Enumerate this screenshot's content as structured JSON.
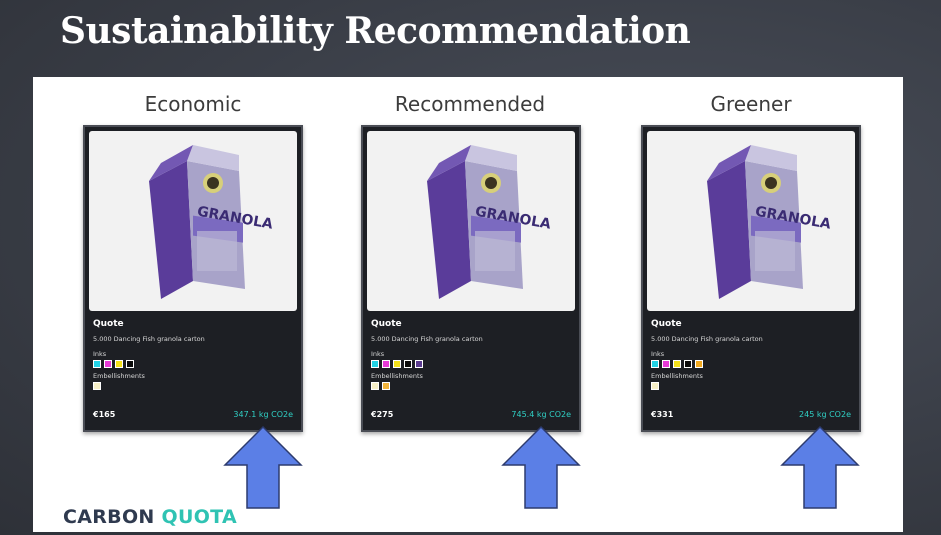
{
  "slide": {
    "title": "Sustainability Recommendation"
  },
  "logo": {
    "part1": "CARBON",
    "part2": "QUOTA"
  },
  "columns": [
    {
      "label": "Economic",
      "quote_title": "Quote",
      "description": "5.000 Dancing Fish granola carton",
      "inks_label": "Inks",
      "inks": [
        "#22d3e6",
        "#e83ad8",
        "#f4e11a",
        "#0a0a0a"
      ],
      "embellishments_label": "Embellishments",
      "embellishments": [
        "#f6efc6"
      ],
      "price": "€165",
      "co2": "347.1 kg CO2e"
    },
    {
      "label": "Recommended",
      "quote_title": "Quote",
      "description": "5.000 Dancing Fish granola carton",
      "inks_label": "Inks",
      "inks": [
        "#22d3e6",
        "#e83ad8",
        "#f4e11a",
        "#0a0a0a",
        "#5b3b8f"
      ],
      "embellishments_label": "Embellishments",
      "embellishments": [
        "#f6efc6",
        "#f2b43a"
      ],
      "price": "€275",
      "co2": "745.4 kg CO2e"
    },
    {
      "label": "Greener",
      "quote_title": "Quote",
      "description": "5.000 Dancing Fish granola carton",
      "inks_label": "Inks",
      "inks": [
        "#22d3e6",
        "#e83ad8",
        "#f4e11a",
        "#0a0a0a",
        "#f2a91f"
      ],
      "embellishments_label": "Embellishments",
      "embellishments": [
        "#f6efc6"
      ],
      "price": "€331",
      "co2": "245 kg CO2e"
    }
  ],
  "colors": {
    "arrow": "#5b7fe6",
    "co2_text": "#30d0c5",
    "card_bg": "#1d1f24"
  },
  "icons": {
    "product_image": "granola-carton-icon",
    "pointer": "up-arrow-icon"
  }
}
